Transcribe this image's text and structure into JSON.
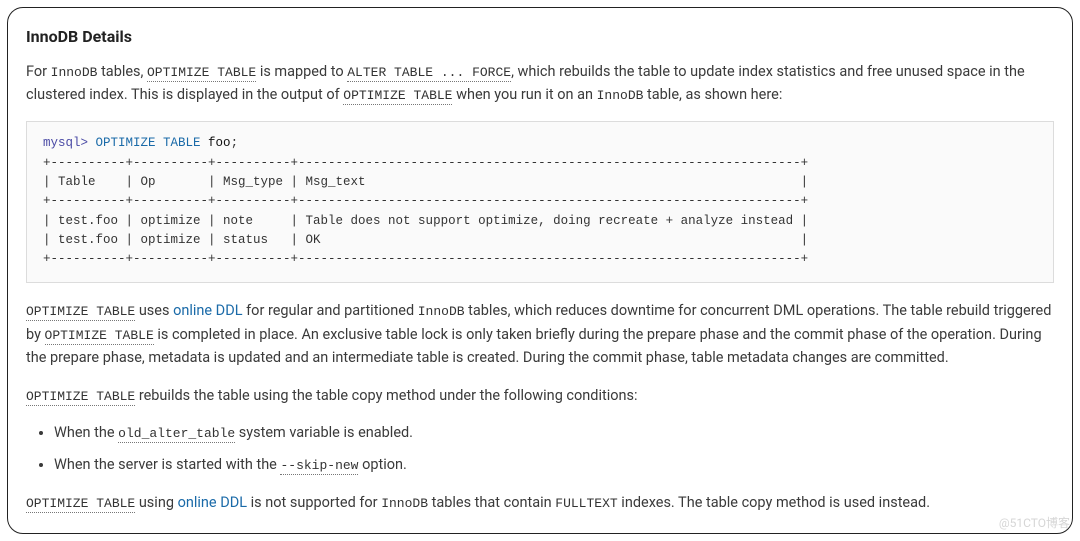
{
  "heading": "InnoDB Details",
  "intro": {
    "p1_a": "For ",
    "innodb": "InnoDB",
    "p1_b": " tables, ",
    "opt_table": "OPTIMIZE TABLE",
    "p1_c": " is mapped to ",
    "alter_force": "ALTER TABLE ... FORCE",
    "p1_d": ", which rebuilds the table to update index statistics and free unused space in the clustered index. This is displayed in the output of ",
    "p1_e": " when you run it on an ",
    "p1_f": " table, as shown here:"
  },
  "code": {
    "prompt": "mysql>",
    "stmt": " OPTIMIZE TABLE ",
    "name": "foo",
    "semi": ";",
    "sep": "+----------+----------+----------+-------------------------------------------------------------------+",
    "hdr": "| Table    | Op       | Msg_type | Msg_text                                                          |",
    "row1": "| test.foo | optimize | note     | Table does not support optimize, doing recreate + analyze instead |",
    "row2": "| test.foo | optimize | status   | OK                                                                |"
  },
  "para2": {
    "a": " uses ",
    "online_ddl": "online DDL",
    "b": " for regular and partitioned ",
    "c": " tables, which reduces downtime for concurrent DML operations. The table rebuild triggered by ",
    "d": " is completed in place. An exclusive table lock is only taken briefly during the prepare phase and the commit phase of the operation. During the prepare phase, metadata is updated and an intermediate table is created. During the commit phase, table metadata changes are committed."
  },
  "para3": {
    "a": " rebuilds the table using the table copy method under the following conditions:"
  },
  "conditions": {
    "c1_a": "When the ",
    "old_alter_table": "old_alter_table",
    "c1_b": " system variable is enabled.",
    "c2_a": "When the server is started with the ",
    "skip_new": "--skip-new",
    "c2_b": " option."
  },
  "para4": {
    "a": " using ",
    "b": " is not supported for ",
    "c": " tables that contain ",
    "fulltext": "FULLTEXT",
    "d": " indexes. The table copy method is used instead."
  },
  "watermark": "@51CTO博客"
}
